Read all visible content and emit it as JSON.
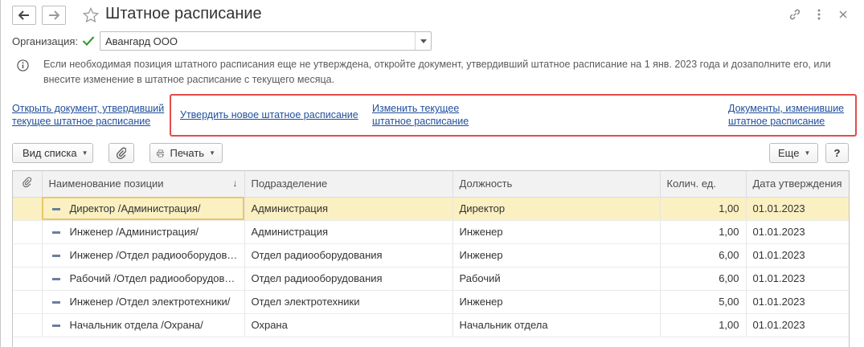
{
  "window": {
    "title": "Штатное расписание"
  },
  "organization": {
    "label": "Организация:",
    "value": "Авангард ООО"
  },
  "info": {
    "text": "Если необходимая позиция штатного расписания еще не утверждена, откройте документ, утвердивший штатное расписание на 1 янв. 2023 года и дозаполните его, или внесите изменение в штатное расписание с текущего месяца."
  },
  "links": {
    "open_doc_line1": "Открыть документ, утвердивший",
    "open_doc_line2": "текущее штатное расписание",
    "approve_new": "Утвердить новое штатное расписание",
    "change_current_line1": "Изменить текущее",
    "change_current_line2": "штатное расписание",
    "docs_changed_line1": "Документы, изменившие",
    "docs_changed_line2": "штатное расписание"
  },
  "toolbar": {
    "view_list": "Вид списка",
    "print": "Печать",
    "more": "Еще",
    "help": "?"
  },
  "table": {
    "columns": [
      "Наименование позиции",
      "Подразделение",
      "Должность",
      "Колич. ед.",
      "Дата утверждения"
    ],
    "rows": [
      {
        "name": "Директор /Администрация/",
        "dept": "Администрация",
        "position": "Директор",
        "qty": "1,00",
        "date": "01.01.2023"
      },
      {
        "name": "Инженер /Администрация/",
        "dept": "Администрация",
        "position": "Инженер",
        "qty": "1,00",
        "date": "01.01.2023"
      },
      {
        "name": "Инженер /Отдел радиооборудования/",
        "dept": "Отдел радиооборудования",
        "position": "Инженер",
        "qty": "6,00",
        "date": "01.01.2023"
      },
      {
        "name": "Рабочий /Отдел радиооборудования/",
        "dept": "Отдел радиооборудования",
        "position": "Рабочий",
        "qty": "6,00",
        "date": "01.01.2023"
      },
      {
        "name": "Инженер /Отдел электротехники/",
        "dept": "Отдел электротехники",
        "position": "Инженер",
        "qty": "5,00",
        "date": "01.01.2023"
      },
      {
        "name": "Начальник отдела /Охрана/",
        "dept": "Охрана",
        "position": "Начальник отдела",
        "qty": "1,00",
        "date": "01.01.2023"
      }
    ]
  },
  "colors": {
    "accent_link": "#1f4f9c",
    "highlight_box": "#e14c4c",
    "selected_row": "#fbf0c2",
    "check_green": "#3c9a3c"
  },
  "icons": [
    "back-arrow-icon",
    "forward-arrow-icon",
    "star-icon",
    "link-icon",
    "more-vertical-icon",
    "close-icon",
    "checkmark-icon",
    "chevron-down-icon",
    "info-icon",
    "paperclip-icon",
    "printer-icon",
    "sort-down-icon"
  ]
}
